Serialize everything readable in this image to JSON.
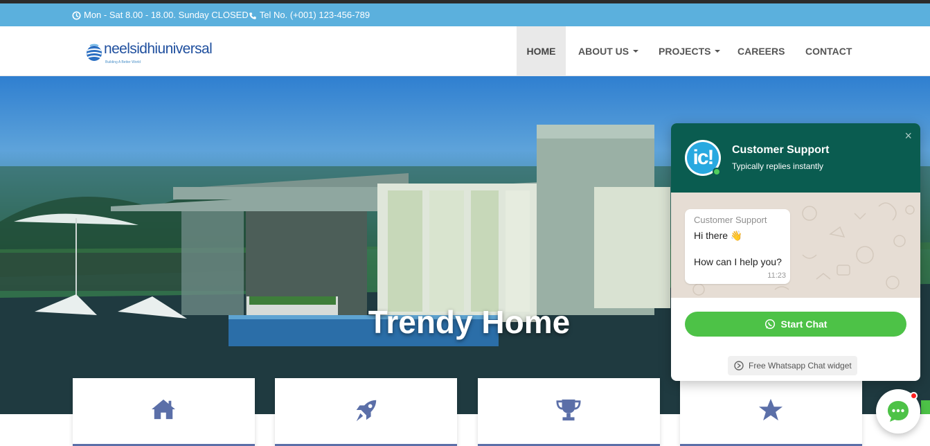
{
  "topbar": {
    "hours": "Mon - Sat 8.00 - 18.00. Sunday CLOSED",
    "phone": "Tel No. (+001) 123-456-789",
    "icons": [
      "clock-icon",
      "phone-icon"
    ]
  },
  "header": {
    "logo_brand": "neelsidhiuniversal",
    "logo_tagline": "Building A Better World",
    "nav": [
      {
        "label": "HOME",
        "active": true
      },
      {
        "label": "ABOUT US",
        "dropdown": true
      },
      {
        "label": "PROJECTS",
        "dropdown": true
      },
      {
        "label": "CAREERS"
      },
      {
        "label": "CONTACT"
      }
    ]
  },
  "hero": {
    "title": "Trendy Home"
  },
  "features": {
    "icons": [
      "home-icon",
      "rocket-icon",
      "trophy-icon",
      "star-icon"
    ],
    "icon_color": "#5b6fa8"
  },
  "chat_widget": {
    "title": "Customer Support",
    "subtitle": "Typically replies instantly",
    "close_symbol": "×",
    "avatar_text": "ic!",
    "message": {
      "sender": "Customer Support",
      "line1": "Hi there 👋",
      "line2": "How can I help you?",
      "time": "11:23"
    },
    "start_button": "Start Chat",
    "credit": "Free Whatsapp Chat widget",
    "colors": {
      "header": "#0a5c50",
      "button": "#4dc247"
    }
  },
  "colors": {
    "info_bar": "#5bb0dd",
    "nav_active": "#e9e9e9"
  }
}
